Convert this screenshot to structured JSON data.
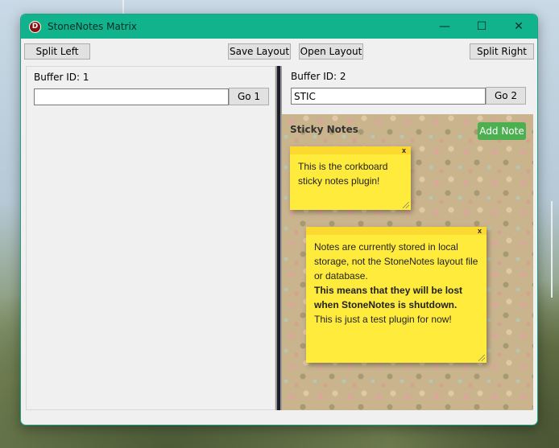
{
  "window": {
    "title": "StoneNotes Matrix",
    "icon_letter": "D",
    "minimize_glyph": "—",
    "maximize_glyph": "☐",
    "close_glyph": "✕"
  },
  "toolbar": {
    "split_left": "Split Left",
    "save_layout": "Save Layout",
    "open_layout": "Open Layout",
    "split_right": "Split Right"
  },
  "left_pane": {
    "buffer_label": "Buffer ID: 1",
    "input_value": "",
    "go_label": "Go 1"
  },
  "right_pane": {
    "buffer_label": "Buffer ID: 2",
    "input_value": "STIC",
    "go_label": "Go 2"
  },
  "sticky": {
    "title": "Sticky Notes",
    "add_label": "Add Note",
    "close_label": "x",
    "note1_text": "This is the corkboard sticky notes plugin!",
    "note2_line1": "Notes are currently stored in local storage, not the StoneNotes layout file or database.",
    "note2_bold": "This means that they will be lost when StoneNotes is shutdown.",
    "note2_line3": "This is just a test plugin for now!"
  },
  "colors": {
    "titlebar": "#10b38c",
    "note": "#ffeb3b",
    "add_button": "#4caf50"
  }
}
